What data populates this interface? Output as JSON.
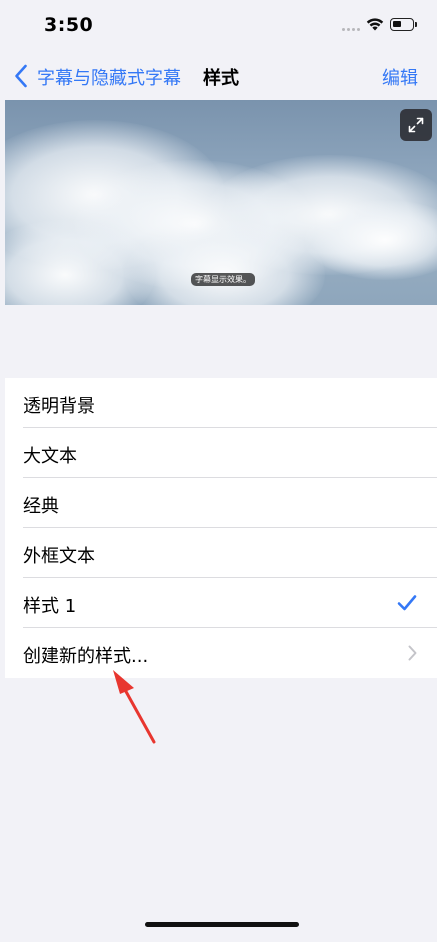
{
  "status_bar": {
    "time": "3:50"
  },
  "nav": {
    "back_label": "字幕与隐藏式字幕",
    "title": "样式",
    "edit_label": "编辑"
  },
  "preview": {
    "caption": "字幕显示效果。"
  },
  "styles": {
    "items": [
      {
        "label": "透明背景"
      },
      {
        "label": "大文本"
      },
      {
        "label": "经典"
      },
      {
        "label": "外框文本"
      },
      {
        "label": "样式 1",
        "selected": true
      },
      {
        "label": "创建新的样式..."
      }
    ]
  },
  "colors": {
    "accent": "#3478f6",
    "background": "#f2f2f7",
    "annotation": "#e8362f"
  },
  "icons": {
    "back": "chevron-left-icon",
    "expand": "expand-icon",
    "check": "checkmark-icon",
    "disclosure": "chevron-right-icon"
  }
}
